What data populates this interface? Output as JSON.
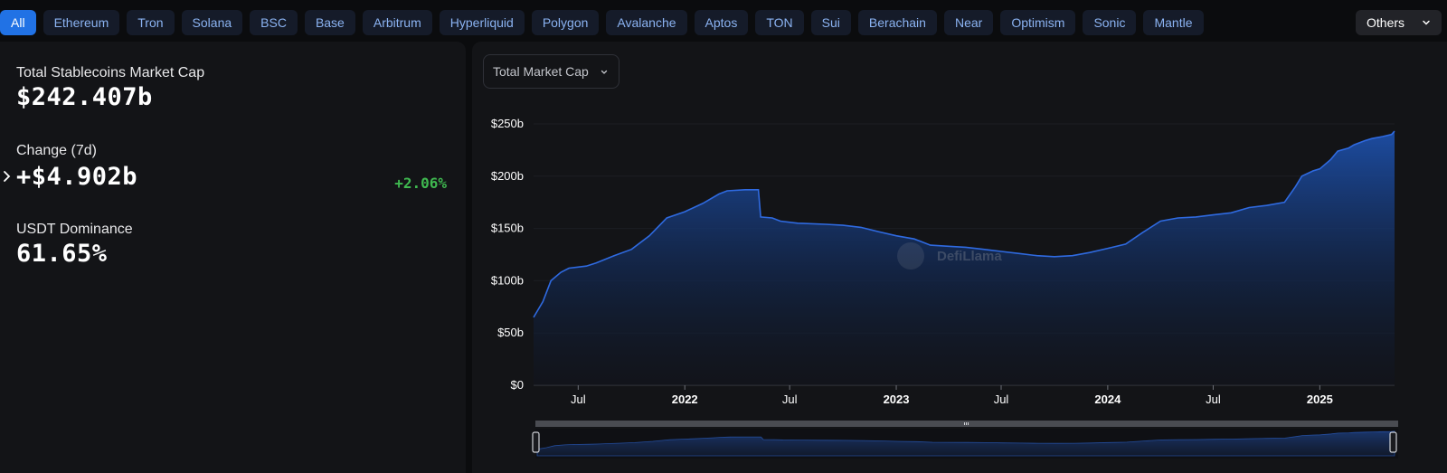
{
  "chains": {
    "tabs": [
      "All",
      "Ethereum",
      "Tron",
      "Solana",
      "BSC",
      "Base",
      "Arbitrum",
      "Hyperliquid",
      "Polygon",
      "Avalanche",
      "Aptos",
      "TON",
      "Sui",
      "Berachain",
      "Near",
      "Optimism",
      "Sonic",
      "Mantle"
    ],
    "active_index": 0,
    "others_label": "Others"
  },
  "stats": {
    "market_cap_label": "Total Stablecoins Market Cap",
    "market_cap_value": "$242.407b",
    "change_label": "Change (7d)",
    "change_value": "+$4.902b",
    "change_percent": "+2.06%",
    "dominance_label": "USDT Dominance",
    "dominance_value": "61.65%"
  },
  "colors": {
    "accent": "#2172e5",
    "positive": "#3fb950",
    "series_line": "#2f6ae0"
  },
  "chart_controls": {
    "metric_select_value": "Total Market Cap"
  },
  "watermark": "DefiLlama",
  "chart_data": {
    "type": "area",
    "ylabel": "",
    "xlabel": "",
    "ylim": [
      0,
      250
    ],
    "y_ticks": [
      "$0",
      "$50b",
      "$100b",
      "$150b",
      "$200b",
      "$250b"
    ],
    "x_ticks": [
      {
        "label": "Jul",
        "date": "2021-07-01",
        "bold": false
      },
      {
        "label": "2022",
        "date": "2022-01-01",
        "bold": true
      },
      {
        "label": "Jul",
        "date": "2022-07-01",
        "bold": false
      },
      {
        "label": "2023",
        "date": "2023-01-01",
        "bold": true
      },
      {
        "label": "Jul",
        "date": "2023-07-01",
        "bold": false
      },
      {
        "label": "2024",
        "date": "2024-01-01",
        "bold": true
      },
      {
        "label": "Jul",
        "date": "2024-07-01",
        "bold": false
      },
      {
        "label": "2025",
        "date": "2025-01-01",
        "bold": true
      }
    ],
    "x_range": [
      "2021-04-15",
      "2025-05-10"
    ],
    "grid": true,
    "series": [
      {
        "points": [
          [
            "2021-04-15",
            65
          ],
          [
            "2021-05-01",
            80
          ],
          [
            "2021-05-15",
            100
          ],
          [
            "2021-06-01",
            108
          ],
          [
            "2021-06-15",
            112
          ],
          [
            "2021-07-15",
            114
          ],
          [
            "2021-08-01",
            117
          ],
          [
            "2021-09-01",
            124
          ],
          [
            "2021-10-01",
            130
          ],
          [
            "2021-11-01",
            143
          ],
          [
            "2021-12-01",
            160
          ],
          [
            "2022-01-01",
            166
          ],
          [
            "2022-02-01",
            174
          ],
          [
            "2022-03-01",
            183
          ],
          [
            "2022-03-15",
            186
          ],
          [
            "2022-04-15",
            187
          ],
          [
            "2022-05-08",
            187
          ],
          [
            "2022-05-12",
            161
          ],
          [
            "2022-06-01",
            160
          ],
          [
            "2022-06-15",
            157
          ],
          [
            "2022-07-15",
            155
          ],
          [
            "2022-09-01",
            154
          ],
          [
            "2022-10-01",
            153
          ],
          [
            "2022-11-01",
            151
          ],
          [
            "2022-12-01",
            147
          ],
          [
            "2023-01-01",
            143
          ],
          [
            "2023-02-01",
            140
          ],
          [
            "2023-03-01",
            134
          ],
          [
            "2023-04-01",
            133
          ],
          [
            "2023-05-01",
            132
          ],
          [
            "2023-06-01",
            130
          ],
          [
            "2023-07-01",
            128
          ],
          [
            "2023-08-01",
            126
          ],
          [
            "2023-09-01",
            124
          ],
          [
            "2023-10-01",
            123
          ],
          [
            "2023-11-01",
            124
          ],
          [
            "2023-12-01",
            127
          ],
          [
            "2024-01-01",
            131
          ],
          [
            "2024-02-01",
            135
          ],
          [
            "2024-03-01",
            146
          ],
          [
            "2024-04-01",
            157
          ],
          [
            "2024-05-01",
            160
          ],
          [
            "2024-06-01",
            161
          ],
          [
            "2024-07-01",
            163
          ],
          [
            "2024-08-01",
            165
          ],
          [
            "2024-09-01",
            170
          ],
          [
            "2024-10-01",
            172
          ],
          [
            "2024-11-01",
            175
          ],
          [
            "2024-11-20",
            190
          ],
          [
            "2024-12-01",
            200
          ],
          [
            "2024-12-20",
            205
          ],
          [
            "2025-01-01",
            207
          ],
          [
            "2025-01-20",
            216
          ],
          [
            "2025-02-01",
            224
          ],
          [
            "2025-02-20",
            227
          ],
          [
            "2025-03-01",
            230
          ],
          [
            "2025-03-20",
            234
          ],
          [
            "2025-04-01",
            236
          ],
          [
            "2025-04-20",
            238
          ],
          [
            "2025-05-05",
            240
          ],
          [
            "2025-05-10",
            243
          ]
        ]
      }
    ]
  }
}
